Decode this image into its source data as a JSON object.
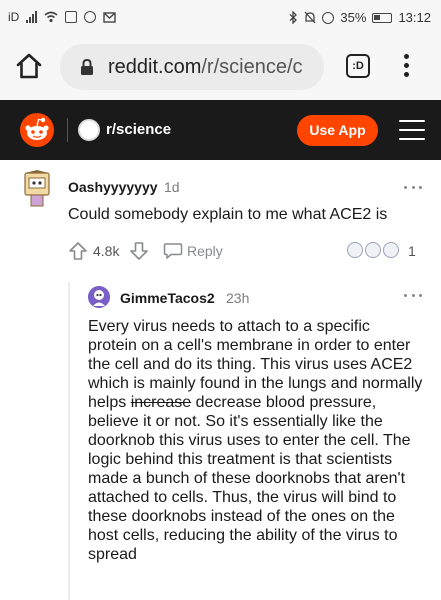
{
  "status_bar": {
    "carrier": "iD",
    "battery": "35%",
    "time": "13:12"
  },
  "browser": {
    "url_host": "reddit.com",
    "url_path": "/r/science/c",
    "tabs_label": ":D"
  },
  "header": {
    "subreddit": "r/science",
    "use_app_label": "Use App"
  },
  "comment": {
    "author": "Oashyyyyyyy",
    "age": "1d",
    "body": "Could somebody explain to me what ACE2 is",
    "score": "4.8k",
    "reply_label": "Reply",
    "award_count": "1",
    "award_icons": [
      "award-icon-1",
      "award-icon-2",
      "award-icon-3"
    ]
  },
  "reply": {
    "author": "GimmeTacos2",
    "age": "23h",
    "body_before": "Every virus needs to attach to a specific protein on a cell's membrane in order to enter the cell and do its thing. This virus uses ACE2 which is mainly found in the lungs and normally helps ",
    "body_struck": "increase",
    "body_after": " decrease blood pressure, believe it or not. So it's essentially like the doorknob this virus uses to enter the cell. The logic behind this treatment is that scientists made a bunch of these doorknobs that aren't attached to cells. Thus, the virus will bind to these doorknobs instead of the ones on the host cells, reducing the ability of the virus to spread"
  },
  "colors": {
    "brand_orange": "#ff4500",
    "header_bg": "#1a1a1b"
  }
}
